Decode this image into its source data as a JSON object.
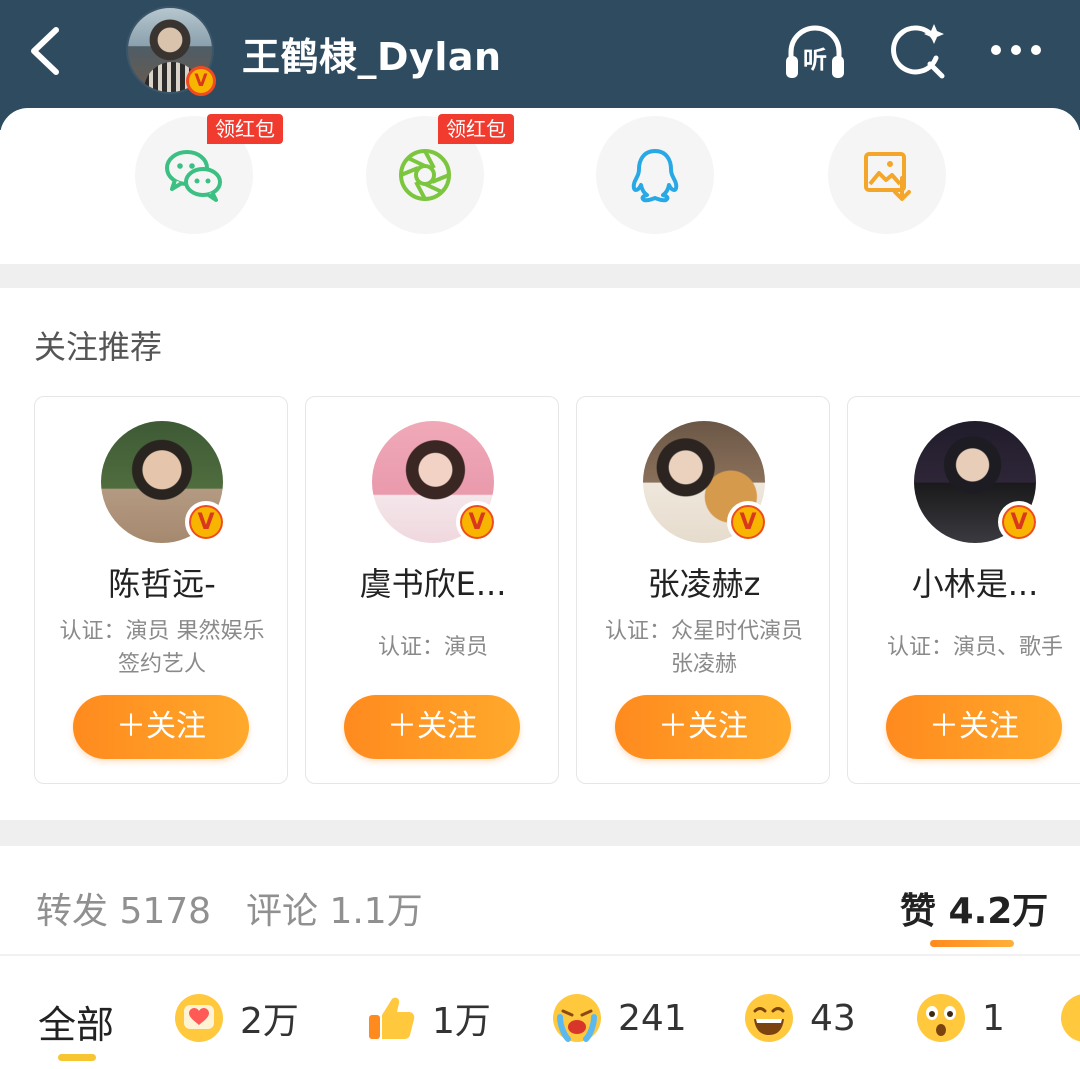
{
  "header": {
    "title": "王鹤棣_Dylan",
    "verified_mark": "V",
    "listen_label": "听"
  },
  "share": {
    "items": [
      {
        "icon": "wechat-icon",
        "badge": "领红包"
      },
      {
        "icon": "moments-icon",
        "badge": "领红包"
      },
      {
        "icon": "qq-icon",
        "badge": ""
      },
      {
        "icon": "save-image-icon",
        "badge": ""
      }
    ]
  },
  "recommend": {
    "title": "关注推荐",
    "cards": [
      {
        "name": "陈哲远-",
        "desc": "认证：演员 果然娱乐签约艺人",
        "follow": "＋关注"
      },
      {
        "name": "虞书欣E...",
        "desc": "认证：演员",
        "follow": "＋关注"
      },
      {
        "name": "张凌赫z",
        "desc": "认证：众星时代演员 张凌赫",
        "follow": "＋关注"
      },
      {
        "name": "小林是...",
        "desc": "认证：演员、歌手",
        "follow": "＋关注"
      }
    ]
  },
  "stats": {
    "repost": "转发 5178",
    "comment": "评论 1.1万",
    "like": "赞 4.2万"
  },
  "reactions": {
    "all_label": "全部",
    "items": [
      {
        "icon": "heart-emoji-icon",
        "count": "2万"
      },
      {
        "icon": "thumbs-up-icon",
        "count": "1万"
      },
      {
        "icon": "crying-emoji-icon",
        "count": "241"
      },
      {
        "icon": "laughing-emoji-icon",
        "count": "43"
      },
      {
        "icon": "surprised-emoji-icon",
        "count": "1"
      }
    ]
  },
  "colors": {
    "header_bg": "#2f4b5f",
    "accent_orange": "#ff8a1e",
    "badge_red": "#f23b2f"
  }
}
